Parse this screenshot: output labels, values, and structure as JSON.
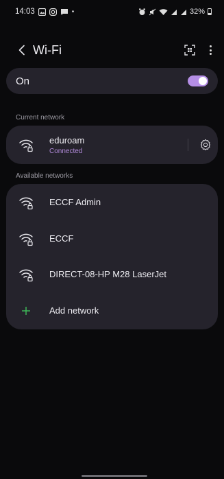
{
  "status_bar": {
    "time": "14:03",
    "left_icons": [
      "image-icon",
      "instagram-icon",
      "messages-icon",
      "dot"
    ],
    "battery": "32%"
  },
  "header": {
    "title": "Wi-Fi"
  },
  "wifi_toggle": {
    "label": "On",
    "state": true
  },
  "current_network": {
    "section_label": "Current network",
    "name": "eduroam",
    "status": "Connected"
  },
  "available": {
    "section_label": "Available networks",
    "networks": [
      {
        "name": "ECCF Admin"
      },
      {
        "name": "ECCF"
      },
      {
        "name": "DIRECT-08-HP M28 LaserJet"
      }
    ],
    "add_label": "Add network"
  },
  "colors": {
    "accent": "#b58ee6",
    "card": "#25232c",
    "background": "#0a0a0c",
    "add_icon": "#3fbf5a"
  }
}
